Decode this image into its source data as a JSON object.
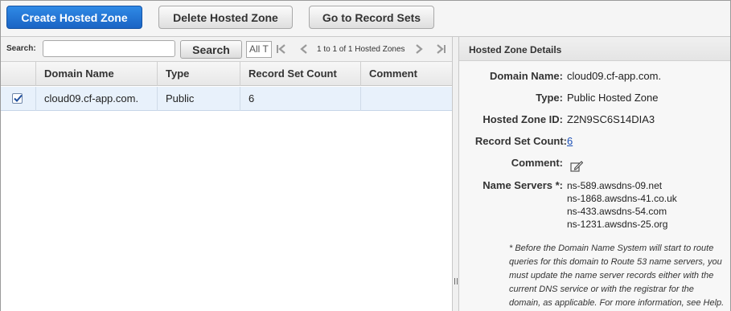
{
  "toolbar": {
    "create_label": "Create Hosted Zone",
    "delete_label": "Delete Hosted Zone",
    "goto_label": "Go to Record Sets"
  },
  "search": {
    "label": "Search:",
    "value": "",
    "button_label": "Search",
    "filter_value": "All T",
    "pager_text": "1 to 1 of 1 Hosted Zones"
  },
  "grid": {
    "columns": [
      "Domain Name",
      "Type",
      "Record Set Count",
      "Comment"
    ],
    "rows": [
      {
        "checked": true,
        "domain": "cloud09.cf-app.com.",
        "type": "Public",
        "count": "6",
        "comment": ""
      }
    ]
  },
  "details": {
    "title": "Hosted Zone Details",
    "domain_label": "Domain Name:",
    "domain_value": "cloud09.cf-app.com.",
    "type_label": "Type:",
    "type_value": "Public Hosted Zone",
    "id_label": "Hosted Zone ID:",
    "id_value": "Z2N9SC6S14DIA3",
    "count_label": "Record Set Count:",
    "count_value": "6",
    "comment_label": "Comment:",
    "ns_label": "Name Servers *:",
    "name_servers": [
      "ns-589.awsdns-09.net",
      "ns-1868.awsdns-41.co.uk",
      "ns-433.awsdns-54.com",
      "ns-1231.awsdns-25.org"
    ],
    "note": "* Before the Domain Name System will start to route queries for this domain to Route 53 name servers, you must update the name server records either with the current DNS service or with the registrar for the domain, as applicable. For more information, see Help."
  },
  "colors": {
    "primary_button": "#1a64c4",
    "selected_row": "#e8f1fb",
    "link": "#1b4fb5"
  },
  "icons": [
    "first-page-icon",
    "prev-page-icon",
    "next-page-icon",
    "last-page-icon",
    "check-icon",
    "edit-icon"
  ]
}
